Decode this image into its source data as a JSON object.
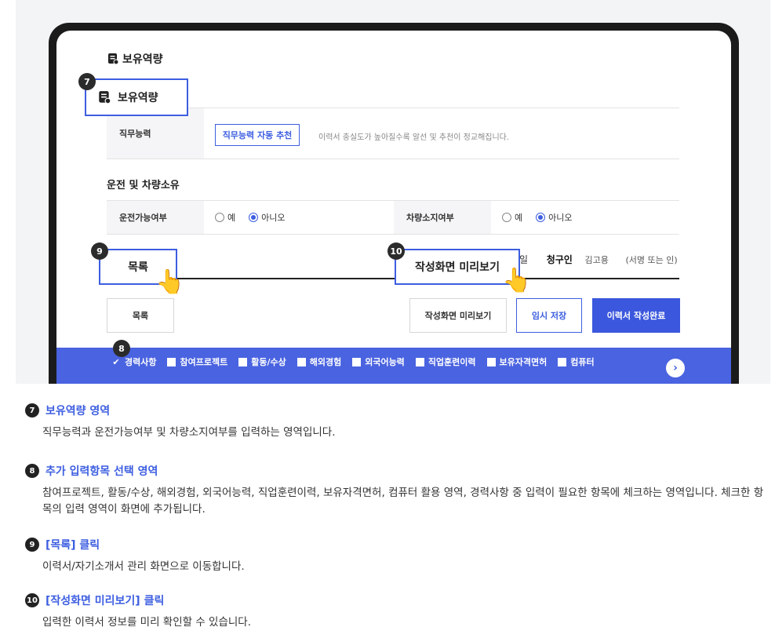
{
  "section_retain": {
    "title": "보유역량",
    "callout_title": "보유역량"
  },
  "job_skill": {
    "label": "직무능력",
    "recommend_button": "직무능력 자동 추천",
    "note": "이력서 충실도가 높아질수록 알선 및 추천이 정교해집니다."
  },
  "driving": {
    "section_title": "운전 및 차량소유",
    "drive_label": "운전가능여부",
    "vehicle_label": "차량소지여부",
    "option_yes": "예",
    "option_no": "아니오"
  },
  "signature": {
    "day_suffix": "일",
    "claimant_label": "청구인",
    "claimant_name": "김고용",
    "sign_note": "(서명 또는 인)"
  },
  "buttons": {
    "list": "목록",
    "preview": "작성화면 미리보기",
    "temp_save": "임시 저장",
    "complete": "이력서 작성완료"
  },
  "callouts": {
    "list": "목록",
    "preview": "작성화면 미리보기"
  },
  "badges": {
    "b7": "7",
    "b8": "8",
    "b9": "9",
    "b10": "10"
  },
  "checkbar": {
    "items": [
      {
        "label": "경력사항",
        "checked": true
      },
      {
        "label": "참여프로젝트",
        "checked": false
      },
      {
        "label": "활동/수상",
        "checked": false
      },
      {
        "label": "해외경험",
        "checked": false
      },
      {
        "label": "외국어능력",
        "checked": false
      },
      {
        "label": "직업훈련이력",
        "checked": false
      },
      {
        "label": "보유자격면허",
        "checked": false
      },
      {
        "label": "컴퓨터",
        "checked": false
      }
    ],
    "next_icon": "chevron-right-icon"
  },
  "descriptions": [
    {
      "num": "7",
      "title": "보유역량 영역",
      "body": "직무능력과 운전가능여부 및 차량소지여부를 입력하는 영역입니다."
    },
    {
      "num": "8",
      "title": "추가 입력항목 선택 영역",
      "body": "참여프로젝트, 활동/수상, 해외경험, 외국어능력, 직업훈련이력, 보유자격면허, 컴퓨터 활용 영역, 경력사항 중 입력이 필요한 항목에 체크하는 영역입니다. 체크한 항목의 입력 영역이 화면에 추가됩니다."
    },
    {
      "num": "9",
      "title": "[목록] 클릭",
      "body": "이력서/자기소개서 관리 화면으로 이동합니다."
    },
    {
      "num": "10",
      "title": "[작성화면 미리보기] 클릭",
      "body": "입력한 이력서 정보를 미리 확인할 수 있습니다."
    }
  ],
  "colors": {
    "accent": "#3d5ee0",
    "bar": "#4a63e0",
    "dark": "#1b1b1b"
  }
}
